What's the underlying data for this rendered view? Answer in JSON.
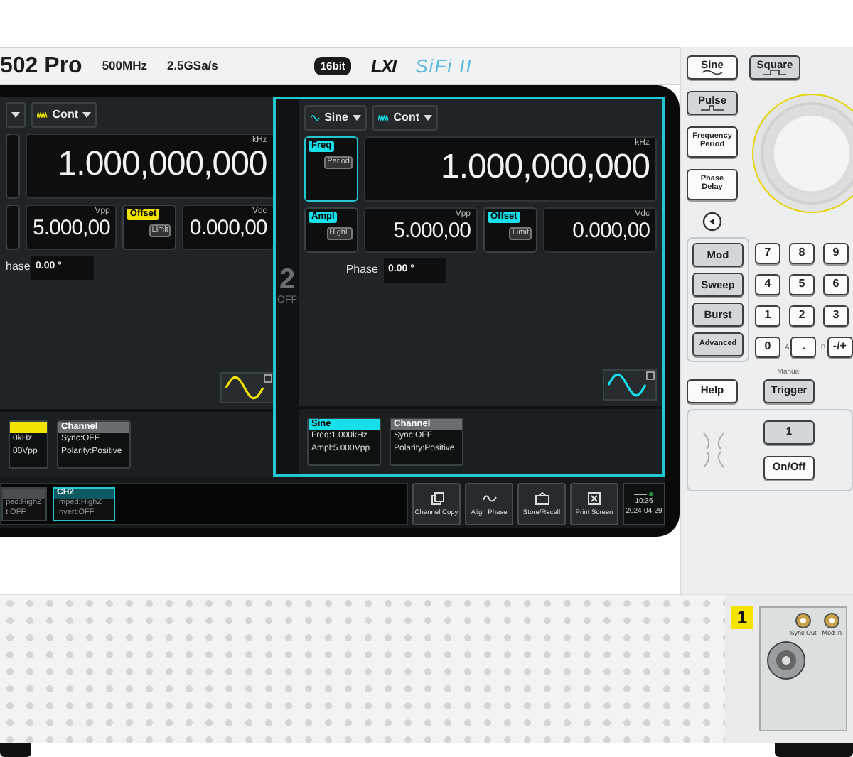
{
  "header": {
    "model": "502 Pro",
    "specs": [
      "500MHz",
      "2.5GSa/s"
    ],
    "badge": "16bit",
    "logos": [
      "LXI",
      "SiFi II"
    ]
  },
  "channels": [
    {
      "color": "#f2e400",
      "cont": "Cont",
      "freq": {
        "value": "1.000,000,000",
        "unit": "kHz"
      },
      "ampl": {
        "value": "5.000,00",
        "unit": "Vpp"
      },
      "offset": {
        "tag": "Offset",
        "sub": "Limit",
        "selected": false,
        "value": "0.000,00",
        "unit": "Vdc"
      },
      "phase": {
        "label": "hase",
        "value": "0.00 °"
      },
      "cards": [
        {
          "kind": "wave",
          "lines": [
            "0kHz",
            "00Vpp"
          ]
        },
        {
          "kind": "channel",
          "title": "Channel",
          "lines": [
            "Sync:OFF",
            "Polarity:Positive"
          ]
        }
      ]
    },
    {
      "color": "#18e0ea",
      "strip": {
        "number": "2",
        "state": "OFF"
      },
      "mode": "Sine",
      "cont": "Cont",
      "freq": {
        "tag": "Freq",
        "sub": "Period",
        "selected": true,
        "value": "1.000,000,000",
        "unit": "kHz"
      },
      "ampl": {
        "tag": "Ampl",
        "sub": "HighL",
        "selected": false,
        "value": "5.000,00",
        "unit": "Vpp"
      },
      "offset": {
        "tag": "Offset",
        "sub": "Limit",
        "selected": false,
        "value": "0.000,00",
        "unit": "Vdc"
      },
      "phase": {
        "label": "Phase",
        "value": "0.00 °"
      },
      "cards": [
        {
          "kind": "wave",
          "title": "Sine",
          "lines": [
            "Freq:1.000kHz",
            "Ampl:5.000Vpp"
          ]
        },
        {
          "kind": "channel",
          "title": "Channel",
          "lines": [
            "Sync:OFF",
            "Polarity:Positive"
          ]
        }
      ]
    }
  ],
  "bottom_bar": {
    "channel_cards": [
      {
        "lines": [
          "ped:HighZ",
          "t:OFF"
        ],
        "selected": false
      },
      {
        "title": "CH2",
        "lines": [
          "Imped:HighZ",
          "Invert:OFF"
        ],
        "selected": true
      }
    ],
    "buttons": [
      {
        "kind": "copy",
        "label": "Channel Copy"
      },
      {
        "kind": "align",
        "label": "Align Phase"
      },
      {
        "kind": "store",
        "label": "Store/Recall"
      },
      {
        "kind": "print",
        "label": "Print Screen"
      }
    ],
    "status": {
      "time": "10:36",
      "date": "2024-04-29"
    }
  },
  "front_panel": {
    "wave_keys": [
      {
        "kind": "sine",
        "label": "Sine"
      },
      {
        "kind": "square",
        "label": "Square"
      },
      {
        "kind": "pulse",
        "label": "Pulse"
      }
    ],
    "param_keys": [
      {
        "lines": [
          "Frequency",
          "Period"
        ]
      },
      {
        "lines": [
          "Phase",
          "Delay"
        ]
      }
    ],
    "mode_keys": [
      "Mod",
      "Sweep",
      "Burst",
      "Advanced"
    ],
    "number_keys": [
      "7",
      "8",
      "9",
      "4",
      "5",
      "6",
      "1",
      "2",
      "3",
      "0",
      ".",
      "-/+"
    ],
    "key_labels": [
      "A",
      "B"
    ],
    "help_key": "Help",
    "trigger": {
      "caption": "Manual",
      "label": "Trigger"
    },
    "output": {
      "channel": "1",
      "toggle": "On/Off"
    }
  },
  "terminal": {
    "channel_badge": "1",
    "ports": [
      "Sync Out",
      "Mod In"
    ]
  }
}
